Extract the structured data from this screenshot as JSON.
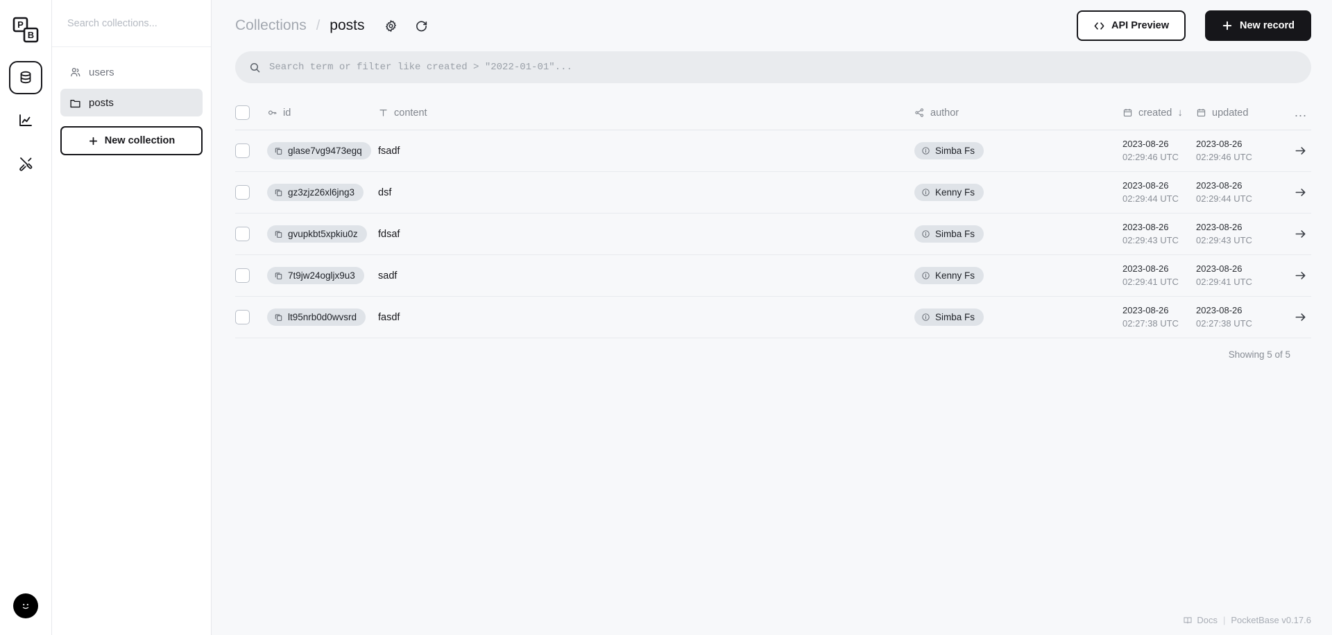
{
  "rail": {
    "logo_label": "PocketBase logo",
    "items": [
      {
        "name": "collections",
        "label": "Collections",
        "icon": "database-icon",
        "active": true
      },
      {
        "name": "logs",
        "label": "Logs",
        "icon": "chart-icon",
        "active": false
      },
      {
        "name": "settings",
        "label": "Settings",
        "icon": "tools-icon",
        "active": false
      }
    ],
    "avatar_label": "Admin account"
  },
  "sidebar": {
    "search": {
      "value": "",
      "placeholder": "Search collections..."
    },
    "collections": [
      {
        "label": "users",
        "icon": "users-icon",
        "active": false
      },
      {
        "label": "posts",
        "icon": "folder-icon",
        "active": true
      }
    ],
    "new_collection_label": "New collection"
  },
  "header": {
    "breadcrumb_root": "Collections",
    "breadcrumb_sep": "/",
    "breadcrumb_current": "posts",
    "gear_title": "Edit collection",
    "refresh_title": "Refresh",
    "api_preview_label": "API Preview",
    "api_preview_icon": "code-icon",
    "new_record_label": "New record",
    "new_record_icon": "plus-icon"
  },
  "filter": {
    "value": "",
    "placeholder": "Search term or filter like created > \"2022-01-01\"...",
    "icon": "search-icon"
  },
  "table": {
    "columns": [
      {
        "key": "id",
        "label": "id",
        "icon": "key-icon"
      },
      {
        "key": "content",
        "label": "content",
        "icon": "text-icon"
      },
      {
        "key": "author",
        "label": "author",
        "icon": "relation-icon"
      },
      {
        "key": "created",
        "label": "created",
        "icon": "calendar-icon",
        "sort": "↓"
      },
      {
        "key": "updated",
        "label": "updated",
        "icon": "calendar-icon",
        "sort": ""
      }
    ],
    "more_label": "...",
    "rows": [
      {
        "id": "glase7vg9473egq",
        "content": "fsadf",
        "author": "Simba Fs",
        "created_date": "2023-08-26",
        "created_time": "02:29:46 UTC",
        "updated_date": "2023-08-26",
        "updated_time": "02:29:46 UTC"
      },
      {
        "id": "gz3zjz26xl6jng3",
        "content": "dsf",
        "author": "Kenny Fs",
        "created_date": "2023-08-26",
        "created_time": "02:29:44 UTC",
        "updated_date": "2023-08-26",
        "updated_time": "02:29:44 UTC"
      },
      {
        "id": "gvupkbt5xpkiu0z",
        "content": "fdsaf",
        "author": "Simba Fs",
        "created_date": "2023-08-26",
        "created_time": "02:29:43 UTC",
        "updated_date": "2023-08-26",
        "updated_time": "02:29:43 UTC"
      },
      {
        "id": "7t9jw24ogljx9u3",
        "content": "sadf",
        "author": "Kenny Fs",
        "created_date": "2023-08-26",
        "created_time": "02:29:41 UTC",
        "updated_date": "2023-08-26",
        "updated_time": "02:29:41 UTC"
      },
      {
        "id": "lt95nrb0d0wvsrd",
        "content": "fasdf",
        "author": "Simba Fs",
        "created_date": "2023-08-26",
        "created_time": "02:27:38 UTC",
        "updated_date": "2023-08-26",
        "updated_time": "02:27:38 UTC"
      }
    ],
    "showing": "Showing 5 of 5"
  },
  "footer": {
    "docs_label": "Docs",
    "docs_icon": "book-icon",
    "separator": "|",
    "version_label": "PocketBase v0.17.6"
  },
  "colors": {
    "accent": "#16161a",
    "page_bg": "#f7f8fa",
    "panel_bg": "#ffffff",
    "pill_bg": "#dfe3e8",
    "muted_text": "#80858d"
  }
}
